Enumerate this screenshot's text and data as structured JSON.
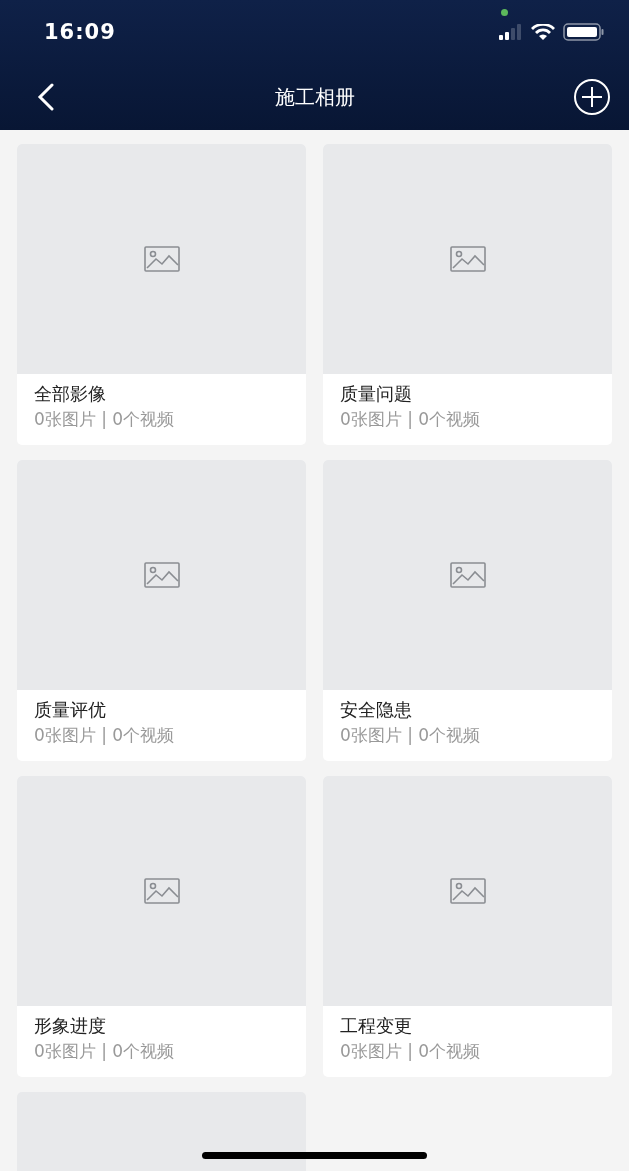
{
  "status_bar": {
    "time": "16:09"
  },
  "nav_bar": {
    "title": "施工相册"
  },
  "albums": [
    {
      "kind": "album",
      "title": "全部影像",
      "counts": "0张图片 | 0个视频"
    },
    {
      "kind": "album",
      "title": "质量问题",
      "counts": "0张图片 | 0个视频"
    },
    {
      "kind": "album",
      "title": "质量评优",
      "counts": "0张图片 | 0个视频"
    },
    {
      "kind": "album",
      "title": "安全隐患",
      "counts": "0张图片 | 0个视频"
    },
    {
      "kind": "album",
      "title": "形象进度",
      "counts": "0张图片 | 0个视频"
    },
    {
      "kind": "album",
      "title": "工程变更",
      "counts": "0张图片 | 0个视频"
    },
    {
      "kind": "cover_only"
    }
  ]
}
